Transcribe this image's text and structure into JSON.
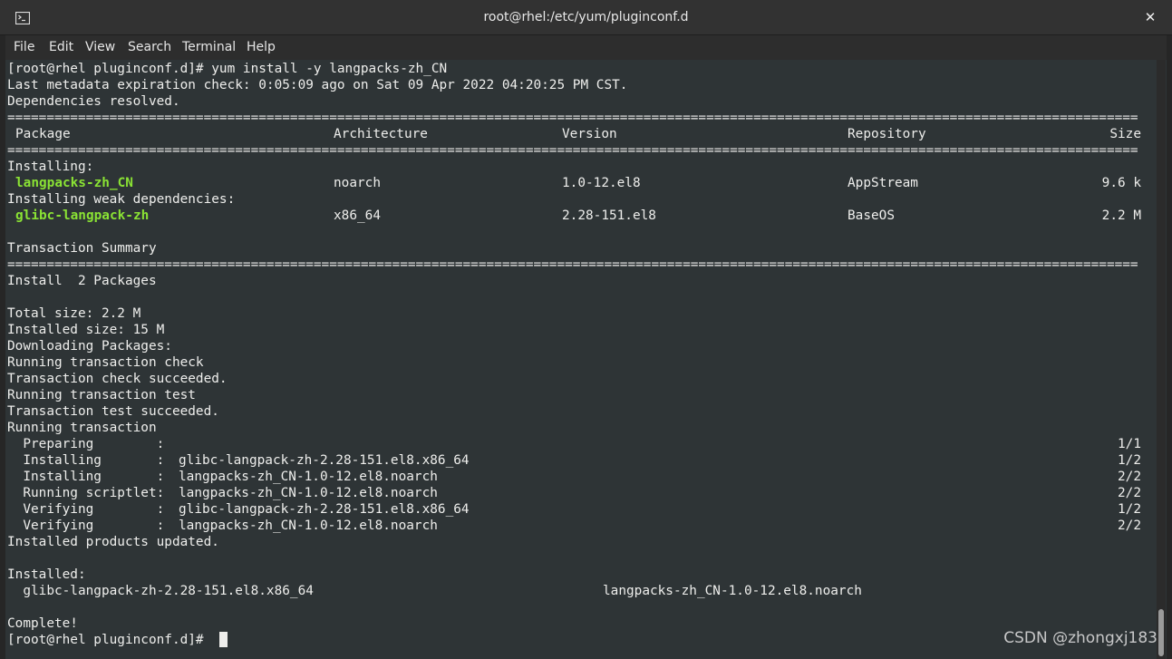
{
  "window": {
    "title": "root@rhel:/etc/yum/pluginconf.d",
    "close_glyph": "✕",
    "icon": "terminal-icon"
  },
  "menu": {
    "file": "File",
    "edit": "Edit",
    "view": "View",
    "search": "Search",
    "terminal": "Terminal",
    "help": "Help"
  },
  "terminal": {
    "line_cmd": "[root@rhel pluginconf.d]# yum install -y langpacks-zh_CN",
    "line_meta": "Last metadata expiration check: 0:05:09 ago on Sat 09 Apr 2022 04:20:25 PM CST.",
    "line_deps": "Dependencies resolved.",
    "separator": "================================================================================================================================================",
    "headers": {
      "package": "Package",
      "architecture": "Architecture",
      "version": "Version",
      "repository": "Repository",
      "size": "Size"
    },
    "installing_label": "Installing:",
    "weak_deps_label": "Installing weak dependencies:",
    "packages": [
      {
        "name": "langpacks-zh_CN",
        "arch": "noarch",
        "version": "1.0-12.el8",
        "repo": "AppStream",
        "size": "9.6 k"
      },
      {
        "name": "glibc-langpack-zh",
        "arch": "x86_64",
        "version": "2.28-151.el8",
        "repo": "BaseOS",
        "size": "2.2 M"
      }
    ],
    "summary_label": "Transaction Summary",
    "install_count": "Install  2 Packages",
    "total_size": "Total size: 2.2 M",
    "installed_size": "Installed size: 15 M",
    "downloading": "Downloading Packages:",
    "run_check": "Running transaction check",
    "check_ok": "Transaction check succeeded.",
    "run_test": "Running transaction test",
    "test_ok": "Transaction test succeeded.",
    "run_tx": "Running transaction",
    "steps": [
      {
        "label": "  Preparing        :",
        "detail": "",
        "count": "1/1"
      },
      {
        "label": "  Installing       :",
        "detail": "glibc-langpack-zh-2.28-151.el8.x86_64",
        "count": "1/2"
      },
      {
        "label": "  Installing       :",
        "detail": "langpacks-zh_CN-1.0-12.el8.noarch",
        "count": "2/2"
      },
      {
        "label": "  Running scriptlet:",
        "detail": "langpacks-zh_CN-1.0-12.el8.noarch",
        "count": "2/2"
      },
      {
        "label": "  Verifying        :",
        "detail": "glibc-langpack-zh-2.28-151.el8.x86_64",
        "count": "1/2"
      },
      {
        "label": "  Verifying        :",
        "detail": "langpacks-zh_CN-1.0-12.el8.noarch",
        "count": "2/2"
      }
    ],
    "products_updated": "Installed products updated.",
    "installed_label": "Installed:",
    "installed_left": "  glibc-langpack-zh-2.28-151.el8.x86_64",
    "installed_right": "langpacks-zh_CN-1.0-12.el8.noarch",
    "complete": "Complete!",
    "prompt": "[root@rhel pluginconf.d]# "
  },
  "watermark": "CSDN @zhongxj183",
  "colors": {
    "background": "#2e3436",
    "foreground": "#eeeeec",
    "package_green": "#8ae234"
  }
}
